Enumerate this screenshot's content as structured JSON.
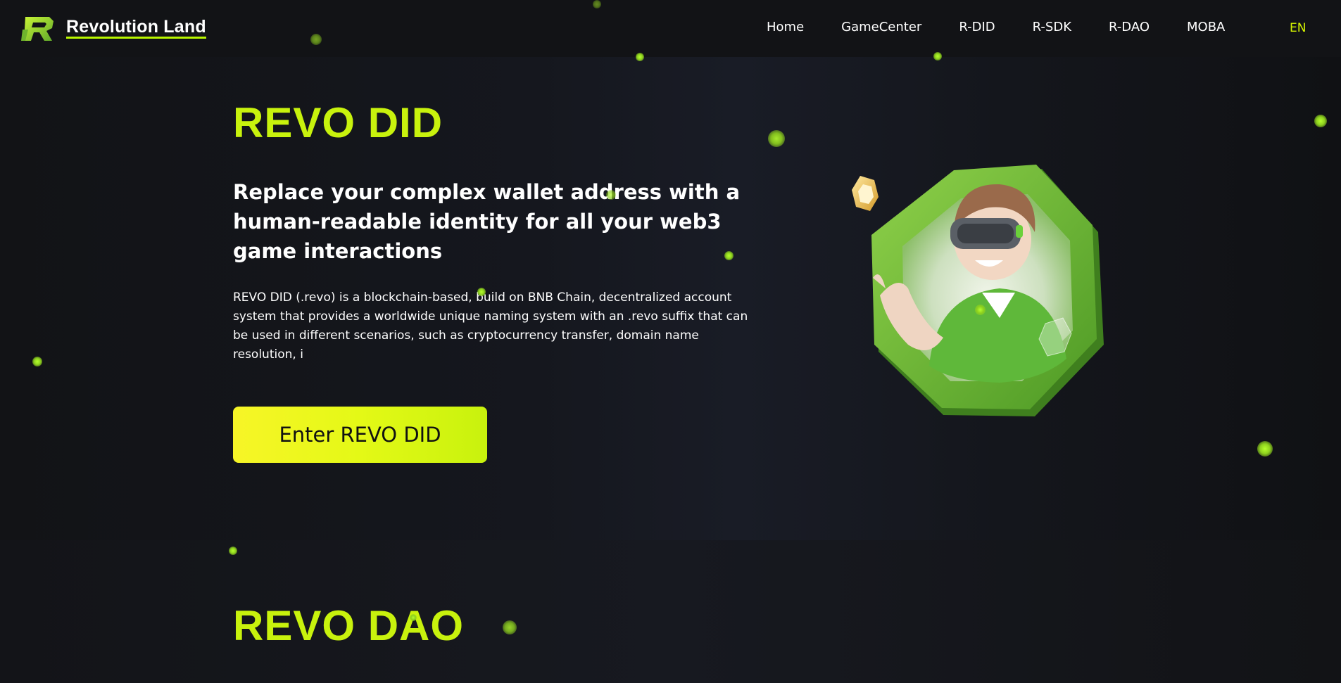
{
  "brand": {
    "name": "Revolution Land",
    "logo_icon": "revolution-land-r-logo",
    "accent_color": "#c8f20d"
  },
  "nav": {
    "items": [
      {
        "label": "Home"
      },
      {
        "label": "GameCenter"
      },
      {
        "label": "R-DID"
      },
      {
        "label": "R-SDK"
      },
      {
        "label": "R-DAO"
      },
      {
        "label": "MOBA"
      }
    ],
    "language": "EN"
  },
  "hero": {
    "title": "REVO DID",
    "subtitle": "Replace your complex wallet address with a human-readable identity for all your web3 game interactions",
    "description": "REVO DID (.revo) is a blockchain-based, build on BNB Chain, decentralized account system that provides a worldwide unique naming system with an .revo suffix that can be used in different scenarios, such as cryptocurrency transfer, domain name resolution, i",
    "button_label": "Enter REVO DID",
    "illustration": "vr-avatar-hexagon-illustration"
  },
  "dao": {
    "title": "REVO DAO"
  }
}
